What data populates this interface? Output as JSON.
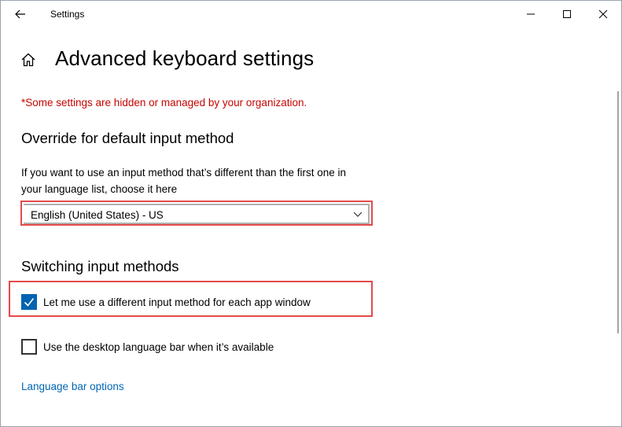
{
  "window": {
    "title": "Settings",
    "controls": {
      "minimize": "minimize-icon",
      "maximize": "maximize-icon",
      "close": "close-icon"
    }
  },
  "page": {
    "title": "Advanced keyboard settings",
    "home_icon": "home-icon",
    "managed_note": "*Some settings are hidden or managed by your organization."
  },
  "override_section": {
    "heading": "Override for default input method",
    "description": "If you want to use an input method that’s different than the first one in your language list, choose it here",
    "dropdown": {
      "selected": "English (United States) - US"
    }
  },
  "switching_section": {
    "heading": "Switching input methods",
    "options": [
      {
        "label": "Let me use a different input method for each app window",
        "checked": true
      },
      {
        "label": "Use the desktop language bar when it’s available",
        "checked": false
      }
    ]
  },
  "links": {
    "language_bar_options": "Language bar options"
  },
  "colors": {
    "accent": "#0063b1",
    "link": "#0066b4",
    "warning": "#c50500",
    "highlight": "#e34a4a"
  }
}
